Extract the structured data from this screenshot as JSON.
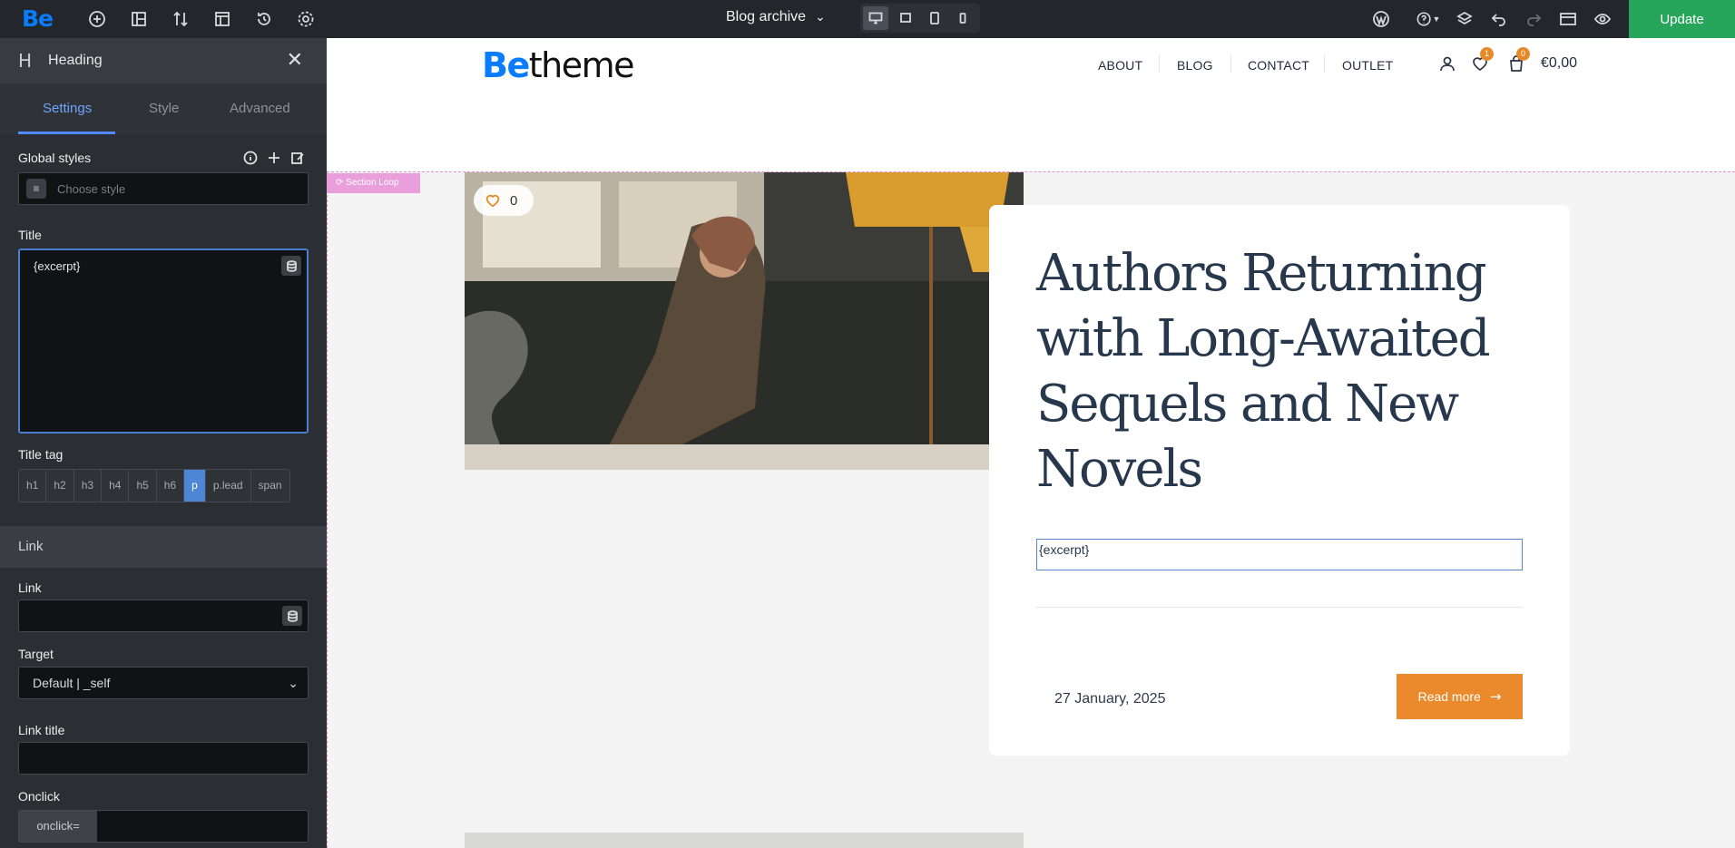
{
  "app": {
    "logo": "Be",
    "archive_label": "Blog archive",
    "update_label": "Update"
  },
  "panel": {
    "title": "Heading",
    "tabs": [
      "Settings",
      "Style",
      "Advanced"
    ],
    "global_styles_label": "Global styles",
    "choose_style_placeholder": "Choose style",
    "title_label": "Title",
    "title_value": "{excerpt}",
    "title_tag_label": "Title tag",
    "tags": [
      "h1",
      "h2",
      "h3",
      "h4",
      "h5",
      "h6",
      "p",
      "p.lead",
      "span"
    ],
    "selected_tag": "p",
    "link_section": "Link",
    "link_label": "Link",
    "target_label": "Target",
    "target_value": "Default | _self",
    "link_title_label": "Link title",
    "onclick_label": "Onclick",
    "onclick_prefix": "onclick="
  },
  "site": {
    "logo_be": "Be",
    "logo_theme": "theme",
    "nav": [
      "ABOUT",
      "BLOG",
      "CONTACT",
      "OUTLET"
    ],
    "wishlist_count": "1",
    "cart_count": "0",
    "price": "€0,00",
    "section_loop": "Section Loop",
    "likes": "0",
    "post_title": "Authors Returning with Long-Awaited Sequels and New Novels",
    "excerpt": "{excerpt}",
    "date": "27 January, 2025",
    "read_more": "Read more"
  },
  "colors": {
    "accent": "#ea8a2c",
    "brand_blue": "#0a7cff",
    "update_green": "#27a55a",
    "selected_blue": "#4e86d6"
  }
}
